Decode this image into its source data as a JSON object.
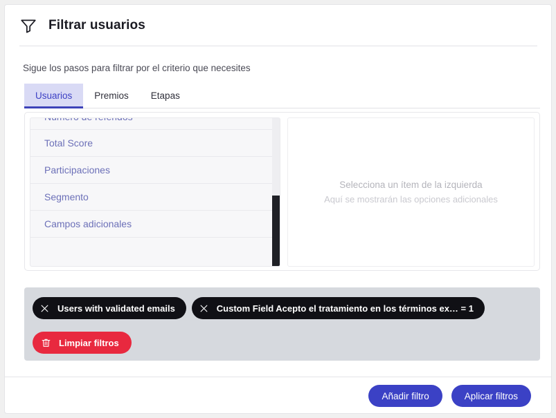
{
  "dialog": {
    "title": "Filtrar usuarios",
    "icon": "funnel-icon",
    "subtitle": "Sigue los pasos para filtrar por el criterio que necesites"
  },
  "tabs": [
    {
      "label": "Usuarios",
      "active": true
    },
    {
      "label": "Premios",
      "active": false
    },
    {
      "label": "Etapas",
      "active": false
    }
  ],
  "list_panel": {
    "items": [
      {
        "label": "Número de referidos"
      },
      {
        "label": "Total Score"
      },
      {
        "label": "Participaciones"
      },
      {
        "label": "Segmento"
      },
      {
        "label": "Campos adicionales"
      }
    ]
  },
  "detail_panel": {
    "title": "Selecciona un ítem de la izquierda",
    "subtitle": "Aquí se mostrarán las opciones adicionales"
  },
  "chips": [
    {
      "label": "Users with validated emails",
      "remove_icon": "close-icon"
    },
    {
      "label": "Custom Field Acepto el tratamiento en los términos ex… = 1",
      "remove_icon": "close-icon"
    }
  ],
  "clear_filters": {
    "label": "Limpiar filtros",
    "icon": "trash-icon"
  },
  "footer": {
    "add_filter_label": "Añadir filtro",
    "apply_filters_label": "Aplicar filtros"
  },
  "colors": {
    "accent": "#3b41c5",
    "tab_active_bg": "#d9daf5",
    "tab_active_text": "#3b3fc4",
    "list_item_text": "#6c70b8",
    "chip_bg": "#101015",
    "clear_bg": "#e8293f",
    "chips_area_bg": "#d6d9de",
    "scrollbar_thumb": "#1f2026"
  }
}
